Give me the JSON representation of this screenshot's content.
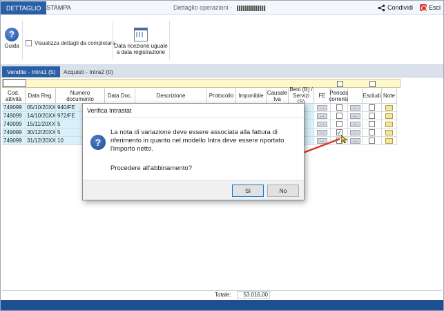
{
  "titlebar": {
    "tabs": [
      {
        "label": "DETTAGLIO",
        "active": true
      },
      {
        "label": "STAMPA",
        "active": false
      }
    ],
    "window_title": "Dettaglio operazioni - ",
    "share_label": "Condividi",
    "exit_label": "Esci"
  },
  "ribbon": {
    "help_label": "Guida",
    "checkbox_label": "Visualizza dettagli da completare",
    "date_button_line1": "Data ricezione uguale",
    "date_button_line2": "a data registrazione"
  },
  "subtabs": [
    {
      "label": "Vendite - Intra1 (5)",
      "active": true
    },
    {
      "label": "Acquisti - Intra2 (0)",
      "active": false
    }
  ],
  "grid": {
    "columns": [
      "Cod. attività",
      "Data Reg.",
      "Numero documento",
      "Data Doc.",
      "Descrizione",
      "Protocollo",
      "Imponibile",
      "Causale Iva",
      "Beni (B) / Servizi (S)",
      "FE",
      "Periodo corrente",
      "",
      "Escludi",
      "Note"
    ],
    "rows": [
      {
        "cod": "749099",
        "data_reg": "05/10/20XX",
        "numero": "940/FE",
        "periodo_checked": false
      },
      {
        "cod": "749099",
        "data_reg": "14/10/20XX",
        "numero": "972/FE",
        "periodo_checked": false
      },
      {
        "cod": "749099",
        "data_reg": "15/11/20XX",
        "numero": "5",
        "periodo_checked": false
      },
      {
        "cod": "749099",
        "data_reg": "30/12/20XX",
        "numero": "5",
        "periodo_checked": true
      },
      {
        "cod": "749099",
        "data_reg": "31/12/20XX",
        "numero": "10",
        "periodo_checked": false
      }
    ],
    "button_glyph": "...",
    "total_label": "Totale:",
    "total_value": "53.016,00"
  },
  "dialog": {
    "title": "Verifica Intrastat",
    "message": "La nota di variazione deve essere associata alla fattura di riferimento in quanto nel modello Intra deve essere riportato l'importo netto.",
    "question": "Procedere all'abbinamento?",
    "yes_label": "Sì",
    "no_label": "No"
  },
  "colors": {
    "accent": "#2a5fa5",
    "row_highlight": "#d7f2fb",
    "filter_bg": "#fff8c8",
    "status_bar": "#1f4f93",
    "arrow": "#d9342b"
  }
}
